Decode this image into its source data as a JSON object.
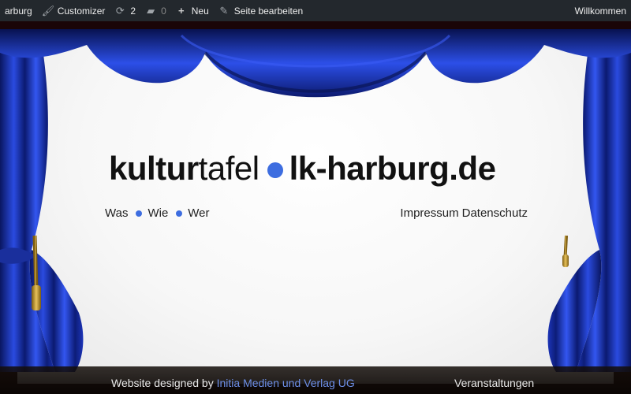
{
  "adminbar": {
    "site_name": "arburg",
    "customizer": "Customizer",
    "updates_count": "2",
    "comments_count": "0",
    "new_label": "Neu",
    "edit_page": "Seite bearbeiten",
    "welcome": "Willkommen"
  },
  "logo": {
    "part1": "kultur",
    "part2": "tafel",
    "part3": "lk-harburg.de"
  },
  "nav": {
    "left": [
      "Was",
      "Wie",
      "Wer"
    ],
    "impressum": "Impressum",
    "datenschutz": "Datenschutz"
  },
  "footer": {
    "credit_prefix": "Website designed by",
    "credit_link": "Initia Medien und Verlag UG",
    "events": "Veranstaltungen"
  },
  "colors": {
    "accent": "#3d6de0",
    "curtain": "#1f3bb3",
    "adminbar": "#23282d"
  }
}
